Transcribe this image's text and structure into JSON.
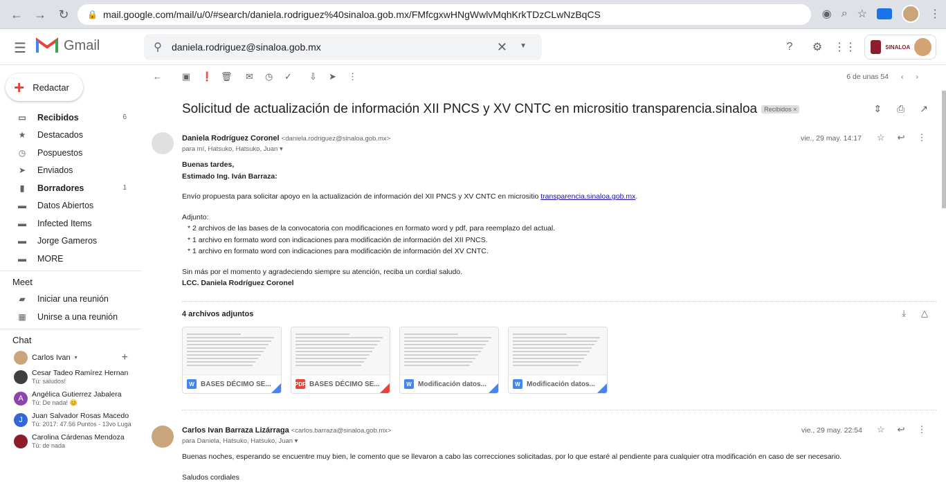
{
  "browser": {
    "url": "mail.google.com/mail/u/0/#search/daniela.rodriguez%40sinaloa.gob.mx/FMfcgxwHNgWwlvMqhKrkTDzCLwNzBqCS"
  },
  "header": {
    "app_name": "Gmail",
    "search_value": "daniela.rodriguez@sinaloa.gob.mx",
    "org_name": "SINALOA"
  },
  "sidebar": {
    "compose": "Redactar",
    "items": [
      {
        "label": "Recibidos",
        "count": "6",
        "bold": true,
        "icon": "inbox-icon"
      },
      {
        "label": "Destacados",
        "count": "",
        "bold": false,
        "icon": "star-icon"
      },
      {
        "label": "Pospuestos",
        "count": "",
        "bold": false,
        "icon": "clock-icon"
      },
      {
        "label": "Enviados",
        "count": "",
        "bold": false,
        "icon": "send-icon"
      },
      {
        "label": "Borradores",
        "count": "1",
        "bold": true,
        "icon": "draft-icon"
      },
      {
        "label": "Datos Abiertos",
        "count": "",
        "bold": false,
        "icon": "label-icon"
      },
      {
        "label": "Infected Items",
        "count": "",
        "bold": false,
        "icon": "label-icon"
      },
      {
        "label": "Jorge Gameros",
        "count": "",
        "bold": false,
        "icon": "label-icon"
      },
      {
        "label": "MORE",
        "count": "",
        "bold": false,
        "icon": "label-icon"
      }
    ],
    "meet_title": "Meet",
    "meet_items": [
      "Iniciar una reunión",
      "Unirse a una reunión"
    ],
    "chat_title": "Chat",
    "chat_user": "Carlos Ivan",
    "chats": [
      {
        "name": "Cesar Tadeo Ramírez Hernan",
        "sub": "Tú: saludos!",
        "initial": "",
        "color": "#3c4043"
      },
      {
        "name": "Angélica Gutierrez Jabalera",
        "sub": "Tú: De nada! 😊",
        "initial": "A",
        "color": "#8e44ad"
      },
      {
        "name": "Juan Salvador Rosas Macedo",
        "sub": "Tú: 2017: 47.56 Puntos - 13vo Luga",
        "initial": "J",
        "color": "#3367d6"
      },
      {
        "name": "Carolina Cárdenas Mendoza",
        "sub": "Tú: de nada",
        "initial": "",
        "color": "#8b1d2c"
      }
    ]
  },
  "toolbar": {
    "pager": "6 de unas 54"
  },
  "thread": {
    "subject": "Solicitud de actualización de información XII PNCS y XV CNTC en micrositio transparencia.sinaloa",
    "label": "Recibidos ×",
    "msg1": {
      "sender": "Daniela Rodríguez Coronel",
      "email": "<daniela.rodriguez@sinaloa.gob.mx>",
      "to": "para mí, Hatsuko, Hatsuko, Juan ▾",
      "date": "vie., 29 may. 14:17",
      "greeting1": "Buenas tardes,",
      "greeting2": "Estimado Ing. Iván Barraza:",
      "para1": "Envío propuesta para solicitar apoyo en la actualización de información del XII PNCS y XV CNTC en micrositio ",
      "link": "transparencia.sinaloa.gob.mx",
      "para1_end": ".",
      "adjunto": "Adjunto:",
      "bullets": [
        "* 2 archivos de las bases de la convocatoria con modificaciones en formato word y pdf, para reemplazo del actual.",
        "* 1 archivo en formato word con indicaciones para modificación de información del XII PNCS.",
        "* 1 archivo en formato word con indicaciones para modificación de información del XV CNTC."
      ],
      "closing": "Sin más por el momento y agradeciendo siempre su atención, reciba un cordial saludo.",
      "signature": "LCC. Daniela Rodríguez Coronel",
      "attachments_title": "4 archivos adjuntos",
      "attachments": [
        {
          "name": "BASES DÉCIMO SE...",
          "type": "W",
          "color": "#4285f4"
        },
        {
          "name": "BASES DÉCIMO SE...",
          "type": "PDF",
          "color": "#ea4335"
        },
        {
          "name": "Modificación datos...",
          "type": "W",
          "color": "#4285f4"
        },
        {
          "name": "Modificación datos...",
          "type": "W",
          "color": "#4285f4"
        }
      ]
    },
    "msg2": {
      "sender": "Carlos Ivan Barraza Lizárraga",
      "email": "<carlos.barraza@sinaloa.gob.mx>",
      "to": "para Daniela, Hatsuko, Hatsuko, Juan ▾",
      "date": "vie., 29 may. 22:54",
      "body": "Buenas noches, esperando se encuentre muy bien, le comento que se llevaron a cabo las correcciones solicitadas, por lo que estaré al pendiente para cualquier otra modificación en caso de ser necesario.",
      "closing": "Saludos cordiales"
    }
  }
}
